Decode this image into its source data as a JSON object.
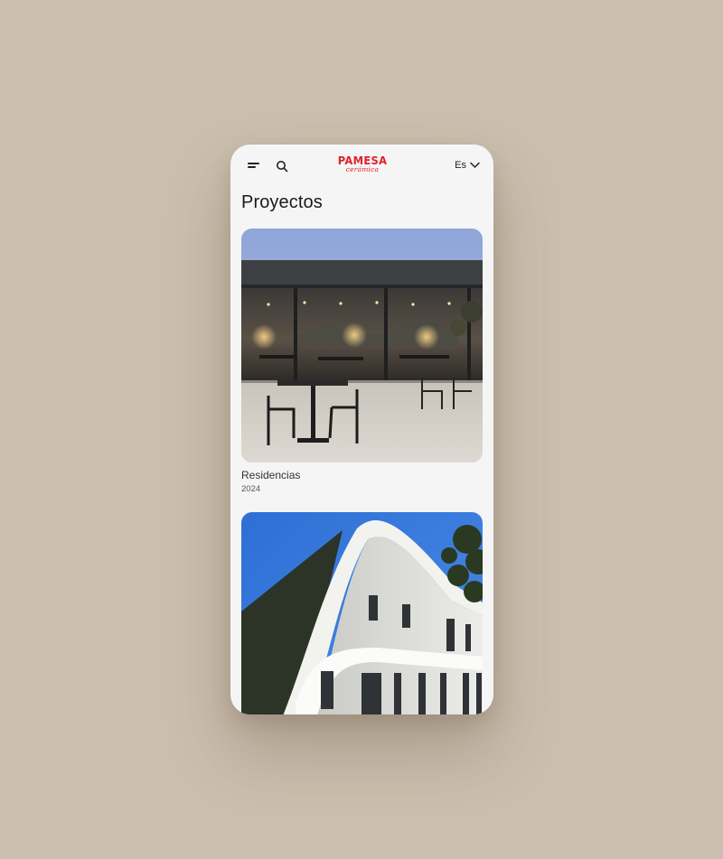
{
  "header": {
    "brand": "PAMESA",
    "brand_sub": "cerámica",
    "language": "Es",
    "icons": [
      "menu-icon",
      "search-icon",
      "chevron-down-icon"
    ]
  },
  "page": {
    "title": "Proyectos"
  },
  "projects": [
    {
      "title": "Residencias",
      "year": "2024",
      "image": "restaurant-terrace-photo"
    },
    {
      "title": "",
      "year": "",
      "image": "curved-white-building-photo"
    }
  ],
  "colors": {
    "background": "#cbbeae",
    "screen": "#f5f5f5",
    "brand_red": "#e3202a",
    "text": "#1a1a1a"
  }
}
